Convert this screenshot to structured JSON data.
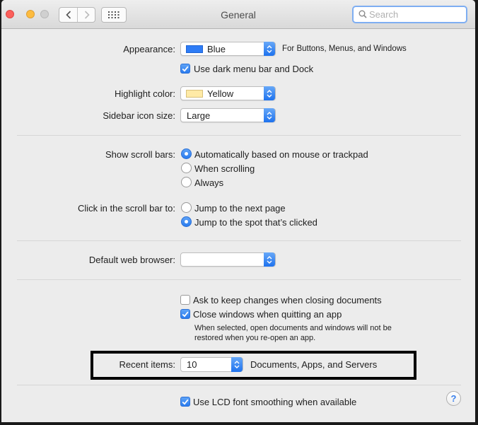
{
  "window": {
    "title": "General"
  },
  "search": {
    "placeholder": "Search",
    "value": ""
  },
  "appearance": {
    "label": "Appearance:",
    "value": "Blue",
    "value_color": "#2e7cf6",
    "note": "For Buttons, Menus, and Windows",
    "dark_menu_label": "Use dark menu bar and Dock",
    "dark_menu_checked": true
  },
  "highlight": {
    "label": "Highlight color:",
    "value": "Yellow",
    "value_color": "#ffeaa6"
  },
  "sidebar_icon": {
    "label": "Sidebar icon size:",
    "value": "Large"
  },
  "scroll_bars": {
    "label": "Show scroll bars:",
    "options": [
      "Automatically based on mouse or trackpad",
      "When scrolling",
      "Always"
    ],
    "selected_index": 0
  },
  "click_scroll": {
    "label": "Click in the scroll bar to:",
    "options": [
      "Jump to the next page",
      "Jump to the spot that’s clicked"
    ],
    "selected_index": 1
  },
  "browser": {
    "label": "Default web browser:",
    "value": ""
  },
  "documents": {
    "ask_keep_label": "Ask to keep changes when closing documents",
    "ask_keep_checked": false,
    "close_windows_label": "Close windows when quitting an app",
    "close_windows_checked": true,
    "note_line1": "When selected, open documents and windows will not be",
    "note_line2": "restored when you re-open an app."
  },
  "recent": {
    "label": "Recent items:",
    "value": "10",
    "suffix": "Documents, Apps, and Servers"
  },
  "lcd": {
    "label": "Use LCD font smoothing when available",
    "checked": true
  },
  "help": {
    "glyph": "?"
  },
  "icons": {
    "back": "chevron-left-icon",
    "forward": "chevron-right-icon",
    "grid": "grid-icon",
    "search": "search-icon",
    "help": "help-icon"
  },
  "colors": {
    "accent": "#2a7bee",
    "window_bg": "#ececec"
  }
}
